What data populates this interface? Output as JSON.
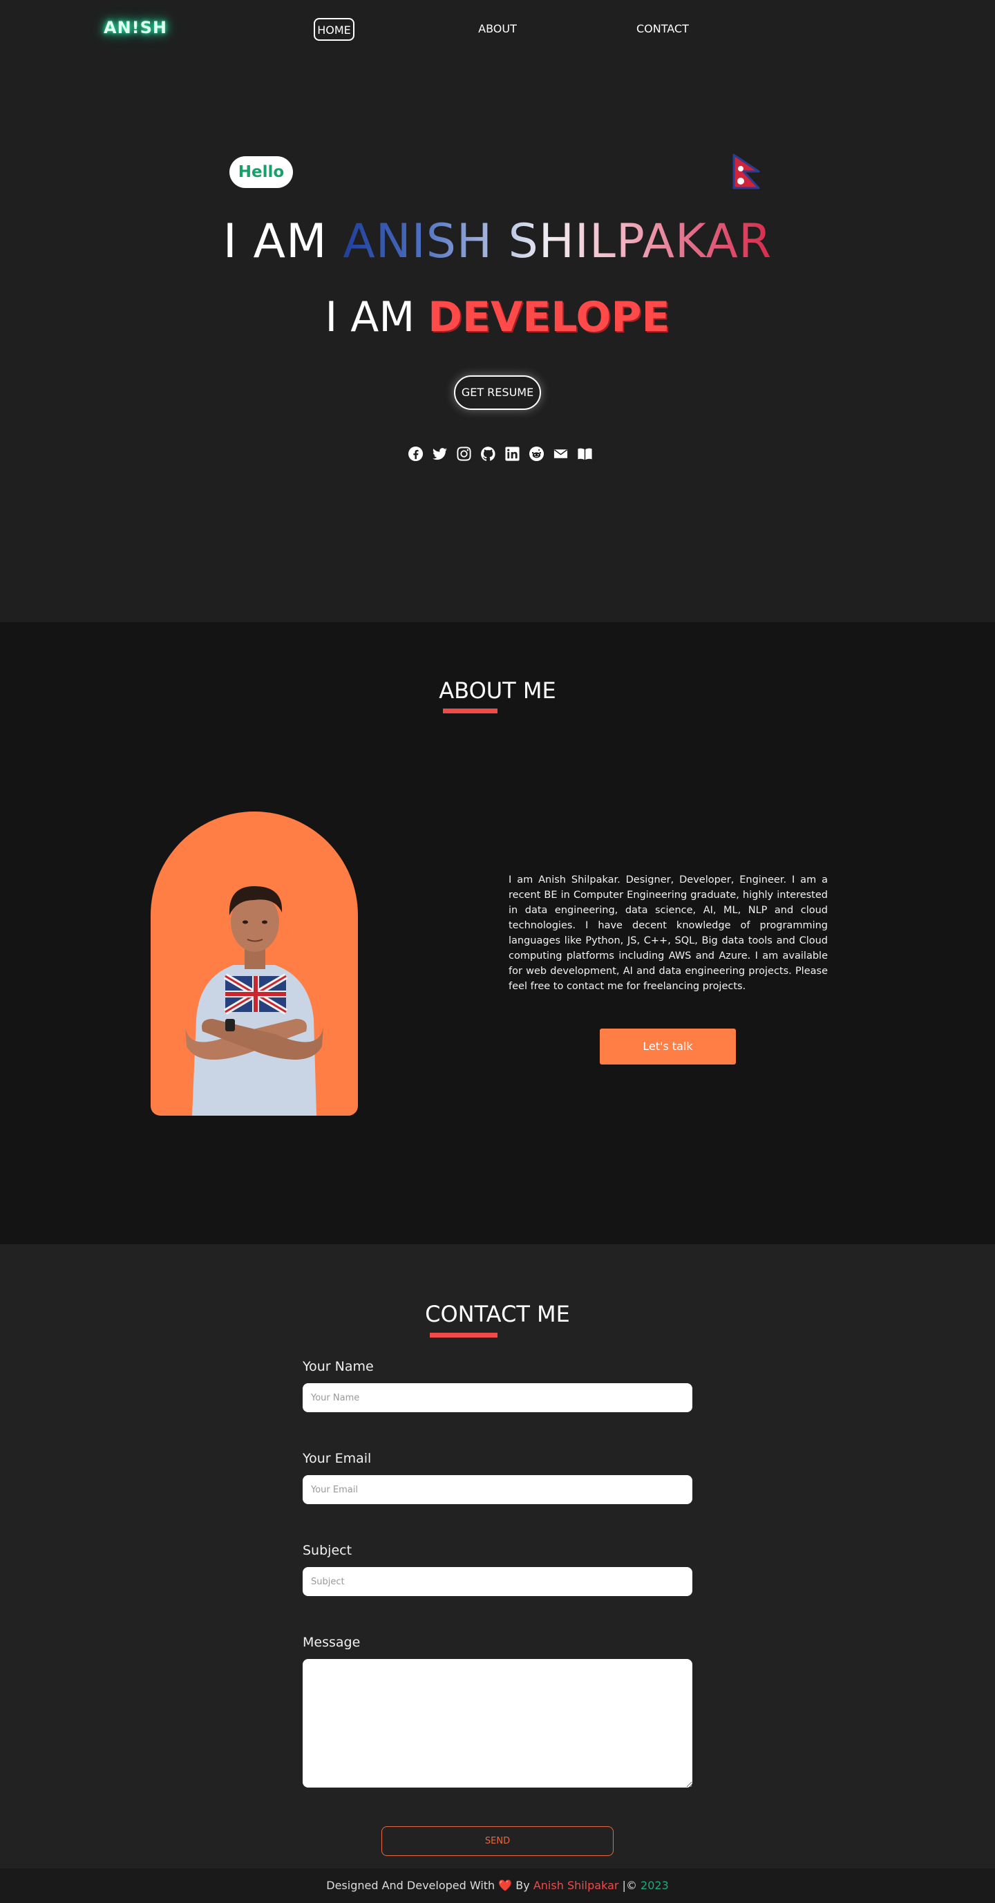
{
  "nav": {
    "logo": "AN!SH",
    "links": [
      "HOME",
      "ABOUT",
      "CONTACT"
    ],
    "active": "HOME"
  },
  "hero": {
    "greeting": "Hello",
    "title_prefix": "I AM",
    "name": "ANISH SHILPAKAR",
    "subtitle_prefix": "I AM",
    "role_typed": "DEVELOPE",
    "resume_button": "GET RESUME",
    "social_icons": [
      "facebook-icon",
      "twitter-icon",
      "instagram-icon",
      "github-icon",
      "linkedin-icon",
      "reddit-icon",
      "email-icon",
      "book-icon"
    ],
    "flag": "nepal-flag"
  },
  "about": {
    "heading": "ABOUT ME",
    "bio": "I am Anish Shilpakar. Designer, Developer, Engineer. I am a recent BE in Computer Engineering graduate, highly interested in data engineering, data science, AI, ML, NLP and cloud technologies. I have decent knowledge of programming languages like Python, JS, C++, SQL, Big data tools and Cloud computing platforms including AWS and Azure. I am available for web development, AI and data engineering projects. Please feel free to contact me for freelancing projects.",
    "cta_button": "Let's talk",
    "photo_bg_color": "#ff7e45"
  },
  "contact": {
    "heading": "CONTACT ME",
    "name_label": "Your Name",
    "name_placeholder": "Your Name",
    "email_label": "Your Email",
    "email_placeholder": "Your Email",
    "subject_label": "Subject",
    "subject_placeholder": "Subject",
    "message_label": "Message",
    "send_button": "SEND"
  },
  "footer": {
    "text_before": "Designed And Developed With",
    "heart": "❤️",
    "by": "By",
    "author": "Anish Shilpakar",
    "separator": "|©",
    "year": "2023"
  },
  "colors": {
    "accent_red": "#f04a4a",
    "accent_orange": "#ff7e45",
    "accent_green": "#1fa87a"
  }
}
